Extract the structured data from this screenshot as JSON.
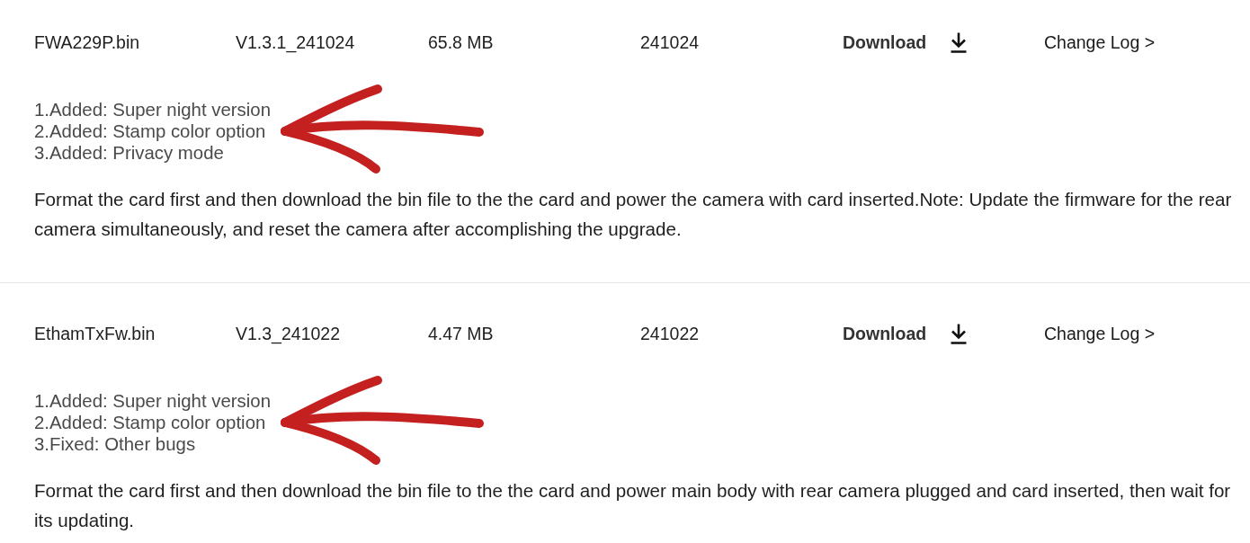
{
  "firmware": [
    {
      "file_name": "FWA229P.bin",
      "version": "V1.3.1_241024",
      "size": "65.8 MB",
      "date": "241024",
      "download_label": "Download",
      "changelog_link": "Change Log >",
      "notes": [
        "1.Added: Super night version",
        "2.Added: Stamp color option",
        "3.Added: Privacy mode"
      ],
      "annotated": true,
      "description": "Format the card first and then download the bin file to the the card and power the camera with card inserted.Note: Update the firmware for the rear camera simultaneously, and reset the camera after accomplishing the upgrade."
    },
    {
      "file_name": "EthamTxFw.bin",
      "version": "V1.3_241022",
      "size": "4.47 MB",
      "date": "241022",
      "download_label": "Download",
      "changelog_link": "Change Log >",
      "notes": [
        "1.Added: Super night version",
        "2.Added: Stamp color option",
        "3.Fixed: Other bugs"
      ],
      "annotated": true,
      "description": "Format the card first and then download the bin file to the the card and power main body with rear camera plugged and card inserted, then wait for its updating."
    }
  ]
}
